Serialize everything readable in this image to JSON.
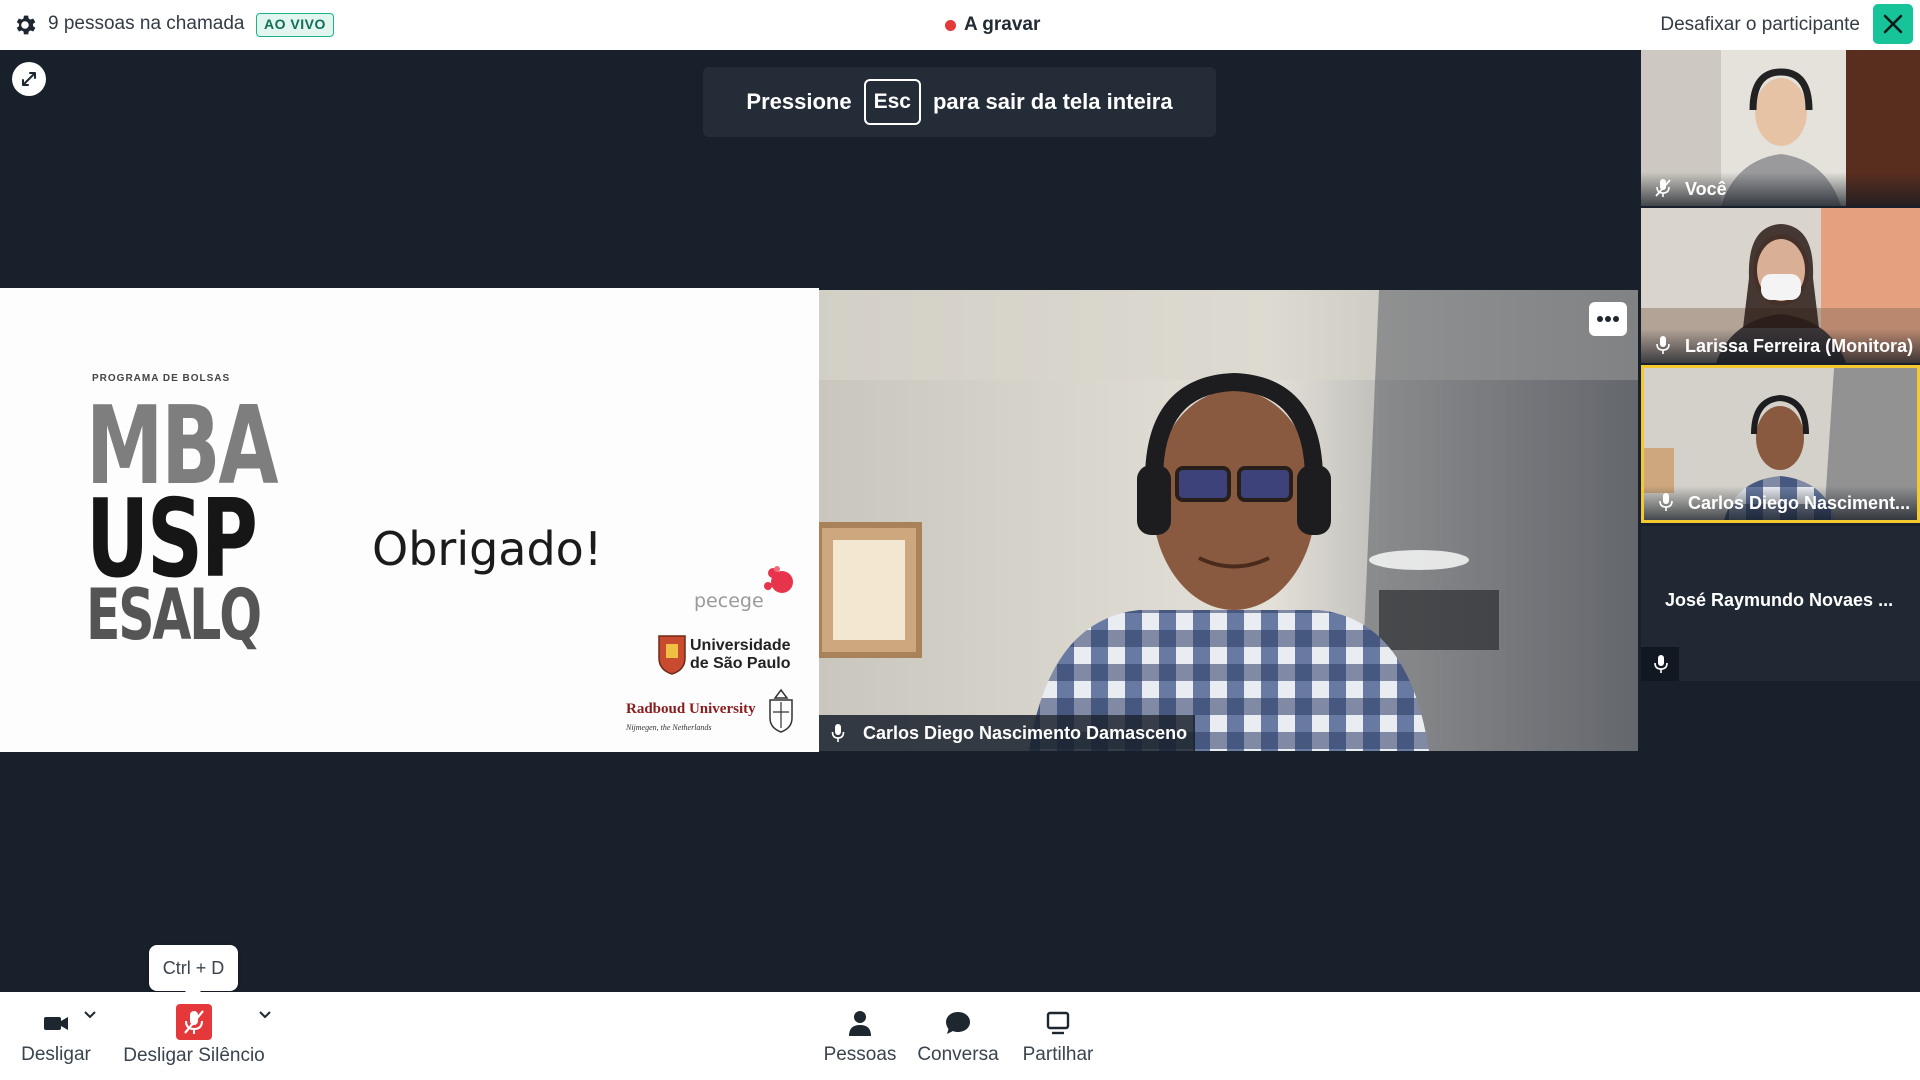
{
  "topbar": {
    "people_count": "9 pessoas na chamada",
    "live_badge": "AO VIVO",
    "recording": "A gravar",
    "unpin_label": "Desafixar o participante"
  },
  "banner": {
    "before": "Pressione",
    "key": "Esc",
    "after": "para sair da tela inteira"
  },
  "slide": {
    "program": "PROGRAMA DE BOLSAS",
    "logo_line1": "MBA",
    "logo_line2": "USP",
    "logo_line3": "ESALQ",
    "thanks": "Obrigado!",
    "pecege": "pecege",
    "usp_line1": "Universidade",
    "usp_line2": "de São Paulo",
    "radboud": "Radboud University",
    "radboud_sub": "Nijmegen, the Netherlands"
  },
  "main_video": {
    "name": "Carlos Diego Nascimento Damasceno"
  },
  "participants": [
    {
      "name": "Você",
      "muted": true
    },
    {
      "name": "Larissa Ferreira (Monitora)",
      "muted": false
    },
    {
      "name": "Carlos Diego Nasciment...",
      "muted": false,
      "active": true
    },
    {
      "name": "José Raymundo Novaes ...",
      "muted": false,
      "video": false
    }
  ],
  "toolbar": {
    "camera_label": "Desligar",
    "mic_label": "Desligar Silêncio",
    "mic_tooltip": "Ctrl + D",
    "people_label": "Pessoas",
    "chat_label": "Conversa",
    "share_label": "Partilhar"
  },
  "colors": {
    "accent": "#17c49a",
    "active_speaker": "#f4c930",
    "muted_red": "#e5383b",
    "stage_bg": "#18202b"
  }
}
